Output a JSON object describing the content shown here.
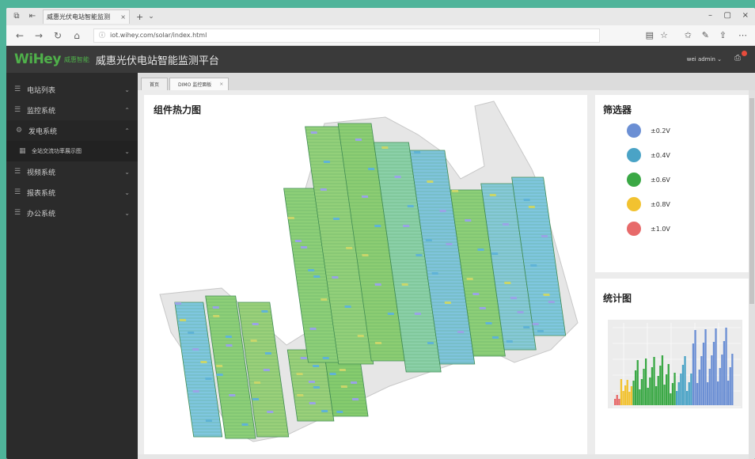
{
  "browser": {
    "tab_title": "威惠光伏电站智能监测",
    "tab_close": "×",
    "new_tab": "+",
    "tab_dropdown": "⌄",
    "url": "iot.wihey.com/solar/index.html",
    "window_controls": [
      "–",
      "▢",
      "×"
    ]
  },
  "app": {
    "logo": "WiHey",
    "logo_sub": "威惠智能",
    "title": "威惠光伏电站智能监测平台",
    "user": "wei  admin",
    "user_chevron": "⌄"
  },
  "sidebar": {
    "items": [
      {
        "label": "电站列表",
        "icon": "list-icon",
        "expanded": false
      },
      {
        "label": "监控系统",
        "icon": "list-icon",
        "expanded": true
      },
      {
        "label": "发电系统",
        "icon": "gear-icon",
        "expanded": true
      },
      {
        "label": "全站交流功率展示图",
        "icon": "grid-icon",
        "expanded": false
      },
      {
        "label": "视频系统",
        "icon": "list-icon",
        "expanded": false
      },
      {
        "label": "报表系统",
        "icon": "list-icon",
        "expanded": false
      },
      {
        "label": "办公系统",
        "icon": "list-icon",
        "expanded": false
      }
    ]
  },
  "content_tabs": [
    {
      "label": "首页",
      "active": false
    },
    {
      "label": "DIMO 监控面板",
      "active": true,
      "close": "×"
    }
  ],
  "heatmap": {
    "title": "组件热力图"
  },
  "filter": {
    "title": "筛选器",
    "items": [
      {
        "label": "±0.2V",
        "color": "#6b8fd4"
      },
      {
        "label": "±0.4V",
        "color": "#4aa3c6"
      },
      {
        "label": "±0.6V",
        "color": "#3aa845"
      },
      {
        "label": "±0.8V",
        "color": "#f2c230"
      },
      {
        "label": "±1.0V",
        "color": "#e76a6a"
      }
    ]
  },
  "stats": {
    "title": "统计图"
  },
  "colors": {
    "accent": "#4fb04a",
    "header_bg": "#3a3a3a",
    "sidebar_bg": "#2b2b2b"
  }
}
